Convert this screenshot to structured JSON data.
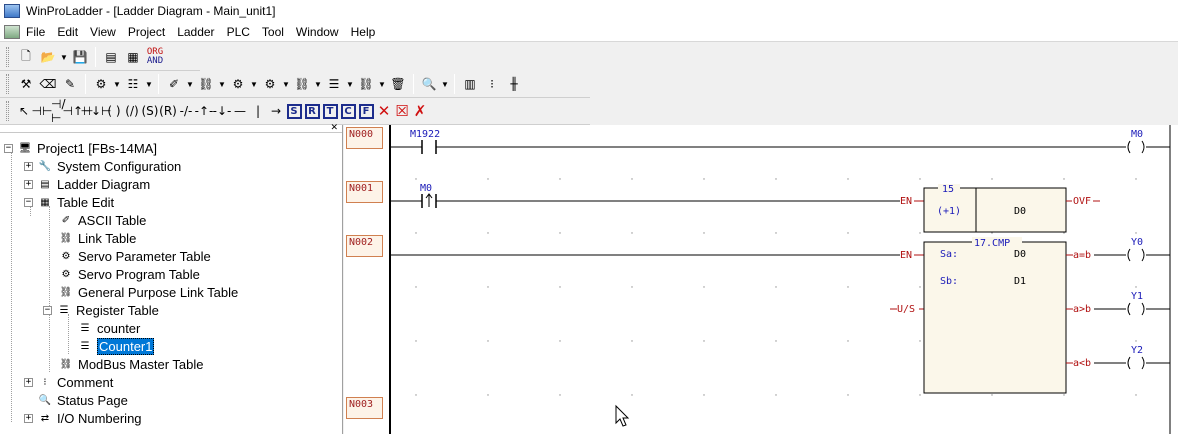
{
  "window": {
    "title": "WinProLadder - [Ladder Diagram - Main_unit1]"
  },
  "menu": [
    "File",
    "Edit",
    "View",
    "Project",
    "Ladder",
    "PLC",
    "Tool",
    "Window",
    "Help"
  ],
  "toolbar": {
    "org_and_line1": "ORG",
    "org_and_line2": "AND",
    "instr_labels": [
      "S",
      "R",
      "T",
      "C",
      "F"
    ]
  },
  "tree": {
    "items": [
      {
        "label": "Project1 [FBs-14MA]"
      },
      {
        "label": "System Configuration"
      },
      {
        "label": "Ladder Diagram"
      },
      {
        "label": "Table Edit"
      },
      {
        "label": "ASCII Table"
      },
      {
        "label": "Link Table"
      },
      {
        "label": "Servo Parameter Table"
      },
      {
        "label": "Servo Program Table"
      },
      {
        "label": "General Purpose Link Table"
      },
      {
        "label": "Register Table"
      },
      {
        "label": "counter"
      },
      {
        "label": "Counter1"
      },
      {
        "label": "ModBus Master Table"
      },
      {
        "label": "Comment"
      },
      {
        "label": "Status Page"
      },
      {
        "label": "I/O Numbering"
      }
    ]
  },
  "ladder": {
    "networks": [
      "N000",
      "N001",
      "N002",
      "N003"
    ],
    "n000": {
      "contact": "M1922",
      "coil": "M0"
    },
    "n001": {
      "contact": "M0",
      "fn_no": "15",
      "fn_name": "(+1)",
      "operand": "D0",
      "en": "EN",
      "ovf": "OVF"
    },
    "n002": {
      "en": "EN",
      "us": "U/S",
      "fn_title": "17.CMP",
      "sa_label": "Sa:",
      "sa_val": "D0",
      "sb_label": "Sb:",
      "sb_val": "D1",
      "out1": "a=b",
      "out2": "a>b",
      "out3": "a<b",
      "coil1": "Y0",
      "coil2": "Y1",
      "coil3": "Y2"
    }
  },
  "colors": {
    "label_blue": "#1a1ab8",
    "label_red": "#b01010",
    "fn_bg": "#fbf7ea",
    "rung_red": "#c02020"
  }
}
